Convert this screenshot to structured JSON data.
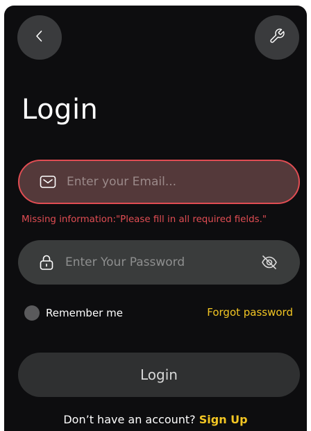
{
  "header": {
    "back_icon": "chevron-left-icon",
    "settings_icon": "wrench-icon"
  },
  "page": {
    "title": "Login"
  },
  "form": {
    "email": {
      "placeholder": "Enter your Email...",
      "value": "",
      "icon": "mail-icon",
      "state": "error"
    },
    "error_message": "Missing information:\"Please fill in all required fields.\"",
    "password": {
      "placeholder": "Enter Your Password",
      "value": "",
      "icon": "lock-icon",
      "toggle_icon": "eye-off-icon"
    },
    "remember_label": "Remember me",
    "remember_checked": false,
    "forgot_label": "Forgot password",
    "submit_label": "Login"
  },
  "footer": {
    "prompt": "Don’t have an account?",
    "signup_label": "Sign Up"
  },
  "colors": {
    "background": "#0d0d0f",
    "accent": "#f3c623",
    "error": "#e14d53",
    "field": "#3a3c3c",
    "error_field": "#54393a"
  }
}
